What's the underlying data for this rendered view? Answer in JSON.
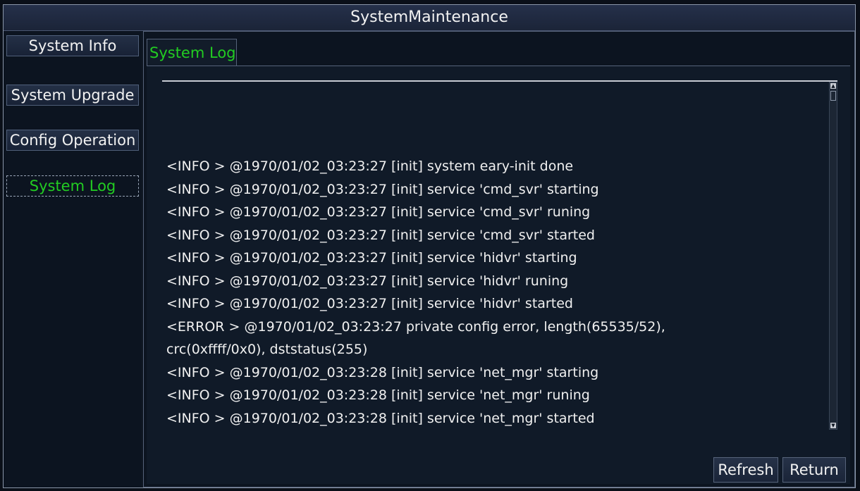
{
  "window": {
    "title": "SystemMaintenance"
  },
  "sidebar": {
    "items": [
      {
        "label": "System Info"
      },
      {
        "label": "System Upgrade"
      },
      {
        "label": "Config Operation"
      },
      {
        "label": "System Log",
        "active": true
      }
    ]
  },
  "main": {
    "tab_label": "System Log",
    "log_lines": [
      "<INFO  > @1970/01/02_03:23:27 [init] system eary-init done",
      "<INFO  > @1970/01/02_03:23:27 [init] service 'cmd_svr' starting",
      "<INFO  > @1970/01/02_03:23:27 [init] service 'cmd_svr' runing",
      "<INFO  > @1970/01/02_03:23:27 [init] service 'cmd_svr' started",
      "<INFO  > @1970/01/02_03:23:27 [init] service 'hidvr' starting",
      "<INFO  > @1970/01/02_03:23:27 [init] service 'hidvr' runing",
      "<INFO  > @1970/01/02_03:23:27 [init] service 'hidvr' started",
      "<ERROR > @1970/01/02_03:23:27 private config error, length(65535/52),",
      "crc(0xffff/0x0), dststatus(255)",
      "<INFO  > @1970/01/02_03:23:28 [init] service 'net_mgr' starting",
      "<INFO  > @1970/01/02_03:23:28 [init] service 'net_mgr' runing",
      "<INFO  > @1970/01/02_03:23:28 [init] service 'net_mgr' started"
    ],
    "refresh_label": "Refresh",
    "return_label": "Return"
  },
  "colors": {
    "active_text": "#22cc22",
    "background": "#0c1420",
    "border": "#56637a"
  },
  "icons": {
    "scroll_up": "scroll-up-arrow-icon",
    "scroll_down": "scroll-down-arrow-icon"
  }
}
